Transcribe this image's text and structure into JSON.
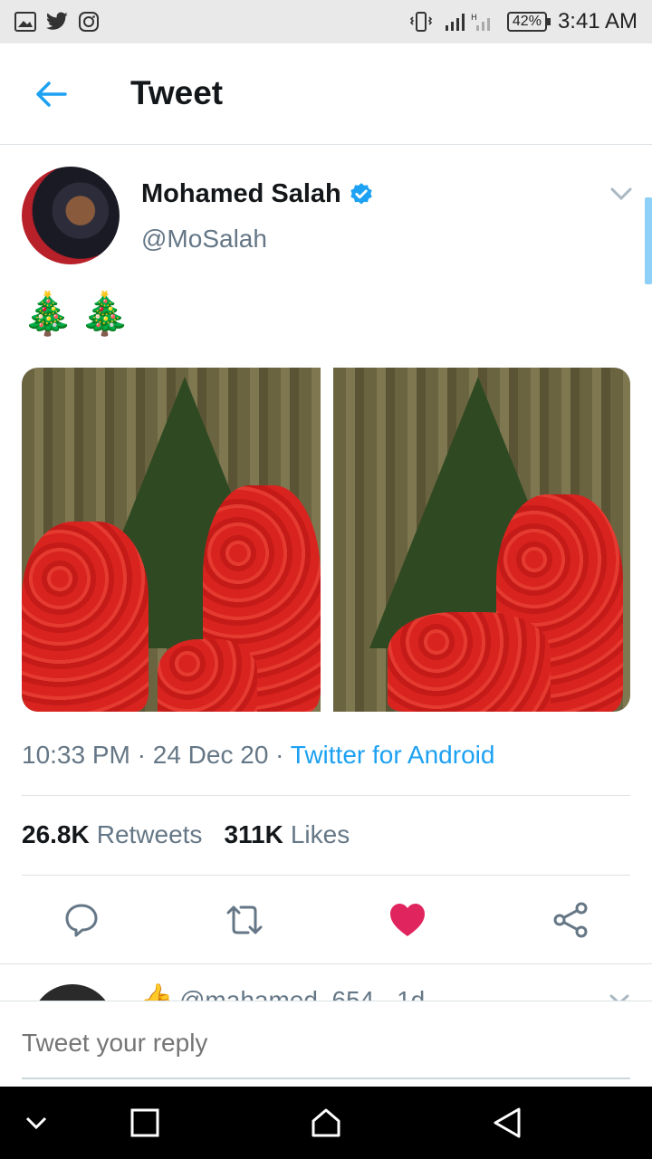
{
  "status_bar": {
    "battery": "42%",
    "time": "3:41 AM"
  },
  "header": {
    "title": "Tweet"
  },
  "tweet": {
    "author_name": "Mohamed Salah",
    "author_handle": "@MoSalah",
    "text": "🎄🎄",
    "time": "10:33 PM",
    "date": "24 Dec 20",
    "source": "Twitter for Android",
    "retweets_count": "26.8K",
    "retweets_label": "Retweets",
    "likes_count": "311K",
    "likes_label": "Likes",
    "liked": true
  },
  "reply_preview": {
    "emoji": "👍",
    "handle_line": "@mahamed_654 · 1d"
  },
  "compose": {
    "placeholder": "Tweet your reply"
  },
  "colors": {
    "accent": "#1da1f2",
    "like": "#e0245e",
    "secondary_text": "#657786"
  },
  "icons": {
    "back": "arrow-left-icon",
    "verified": "verified-badge-icon",
    "caret": "chevron-down-icon",
    "reply": "reply-icon",
    "retweet": "retweet-icon",
    "like": "heart-icon",
    "share": "share-icon"
  }
}
